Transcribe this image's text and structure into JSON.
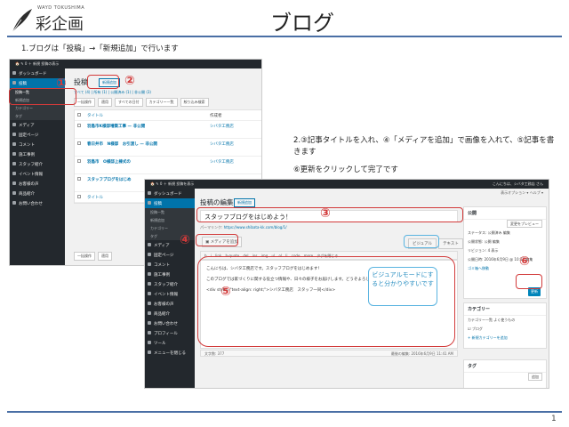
{
  "header": {
    "logo_sub": "WAYD TOKUSHIMA",
    "logo_main": "彩企画",
    "page_title": "ブログ"
  },
  "steps": {
    "step1": "1.ブログは「投稿」→「新規追加」で行います",
    "step2": "2.③記事タイトルを入れ、④「メディアを追加」で画像を入れて、⑤記事を書きます",
    "step6": "⑥更新をクリックして完了です"
  },
  "ss1": {
    "adminbar": "🏠 ✎ 0  ＋ 新規  投稿の表示",
    "sidebar": [
      {
        "label": "ダッシュボード",
        "active": false
      },
      {
        "label": "投稿",
        "active": true
      }
    ],
    "sidebar_sub": [
      "投稿一覧",
      "新規追加",
      "カテゴリー",
      "タグ"
    ],
    "sidebar_rest": [
      "メディア",
      "固定ページ",
      "コメント",
      "施工事例",
      "スタッフ紹介",
      "イベント情報",
      "お客様の声",
      "商品紹介",
      "お問い合わせ"
    ],
    "title": "投稿",
    "new_button": "新規追加",
    "filters": "すべて (4) | 所有 (1) | 公開済み (1) | 非公開 (3)",
    "bulk": "一括操作",
    "apply": "適用",
    "all_dates": "すべての日付",
    "all_cats": "カテゴリー一覧",
    "filter_btn": "絞り込み検索",
    "col_title": "タイトル",
    "col_author": "作成者",
    "rows": [
      {
        "title": "羽島市K様邸増築工事 — 非公開",
        "author": "シバタ工務店"
      },
      {
        "title": "春日井市　N様邸　お引渡し — 非公開",
        "author": "シバタ工務店"
      },
      {
        "title": "羽島市　O様邸上棟式の",
        "author": "シバタ工務店"
      },
      {
        "title": "スタッフブログをはじめ",
        "author": ""
      },
      {
        "title": "タイトル",
        "author": ""
      }
    ],
    "bulk_bottom": "一括操作",
    "apply_bottom": "適用"
  },
  "ss2": {
    "adminbar": "🏠 ✎ 0  ＋ 新規  投稿を表示",
    "adminbar_right": "こんにちは、シバタ工務店 さん",
    "screen_opts": "表示オプション ▾   ヘルプ ▾",
    "sidebar": [
      {
        "label": "ダッシュボード",
        "active": false
      },
      {
        "label": "投稿",
        "active": true
      }
    ],
    "sidebar_sub": [
      "投稿一覧",
      "新規追加",
      "カテゴリー",
      "タグ"
    ],
    "sidebar_rest": [
      "メディア",
      "固定ページ",
      "コメント",
      "施工事例",
      "スタッフ紹介",
      "イベント情報",
      "お客様の声",
      "商品紹介",
      "お問い合わせ",
      "プロフィール",
      "ツール",
      "メニューを閉じる"
    ],
    "edit_title": "投稿の編集",
    "new_button": "新規追加",
    "post_title": "スタッフブログをはじめよう！",
    "permalink_label": "パーマリンク:",
    "permalink_url": "https://www.shibata-kk.com/blog/1/",
    "media_button": "メディアを追加",
    "tab_visual": "ビジュアル",
    "tab_text": "テキスト",
    "toolbar": "b  i  link  b-quote  del  ins  img  ul  ol  li  code  more  タグを閉じる",
    "body_lines": [
      "こんにちは、シバタ工務店です。スタッフブログをはじめます！",
      "このブログでは家づくりに関する役立つ情報や、日々の様子をお届けします。どうぞよろしくお願いいたします。",
      "<div style=\"text-align: right;\">シバタ工務店　スタッフ一同</div>"
    ],
    "word_count": "文字数: 377",
    "last_edit": "最後の編集: 2016年6月9日 11:41 AM",
    "publish_head": "公開",
    "preview_btn": "変更をプレビュー",
    "status_row": "ステータス: 公開済み 編集",
    "visibility_row": "公開状態: 公開 編集",
    "revision_row": "リビジョン: 4 表示",
    "published_row": "公開日時: 2016年6月9日 @ 10:17 編集",
    "trash_link": "ゴミ箱へ移動",
    "update_btn": "更新",
    "category_head": "カテゴリー",
    "cat_tabs": "カテゴリー一覧   よく使うもの",
    "cat_item": "ブログ",
    "add_cat": "+ 新規カテゴリーを追加",
    "tag_head": "タグ",
    "tag_add": "追加"
  },
  "callout": "ビジュアルモードにすると分かりやすいです",
  "markers": {
    "m1": "①",
    "m2": "②",
    "m3": "③",
    "m4": "④",
    "m5": "⑤",
    "m6": "⑥"
  },
  "page_number": "1"
}
